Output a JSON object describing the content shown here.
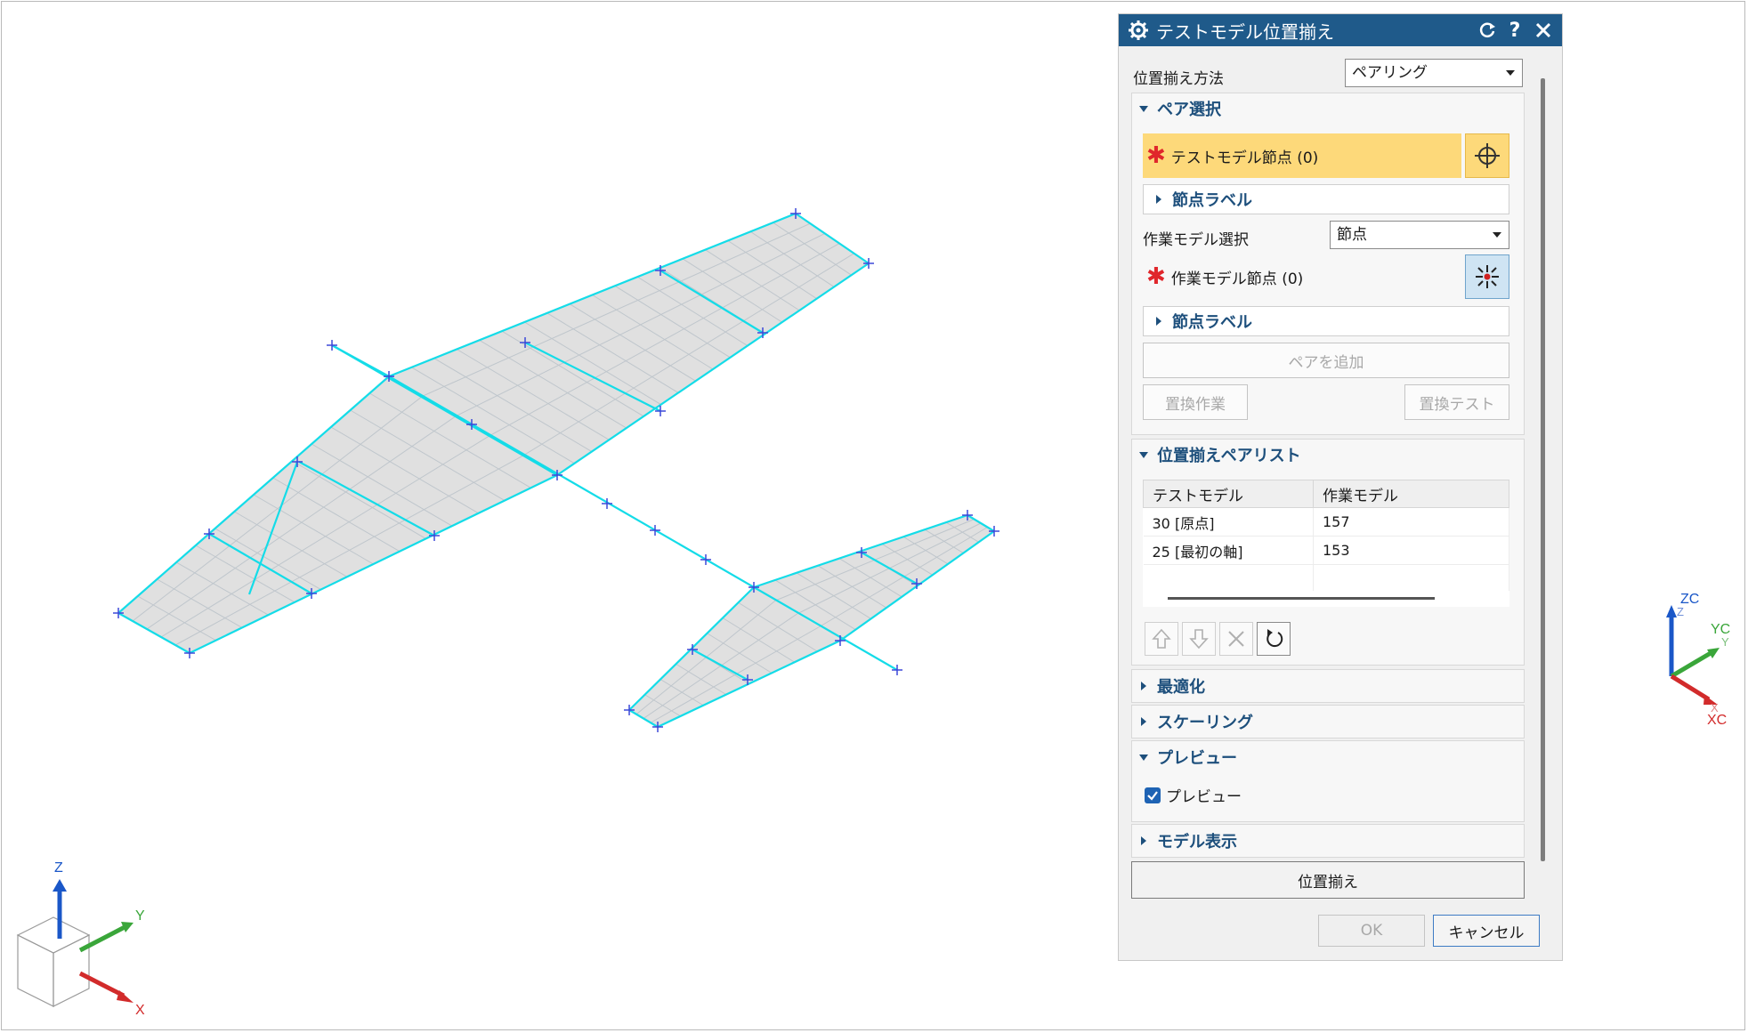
{
  "dialog": {
    "title": "テストモデル位置揃え",
    "method_label": "位置揃え方法",
    "method_value": "ペアリング",
    "pair_selection": {
      "header": "ペア選択",
      "test_nodes": "テストモデル節点 (0)",
      "node_label_1": "節点ラベル",
      "work_select_label": "作業モデル選択",
      "work_select_value": "節点",
      "work_nodes": "作業モデル節点 (0)",
      "node_label_2": "節点ラベル",
      "add_pair": "ペアを追加",
      "replace_work": "置換作業",
      "replace_test": "置換テスト"
    },
    "pair_list": {
      "header": "位置揃えペアリスト",
      "columns": [
        "テストモデル",
        "作業モデル"
      ],
      "rows": [
        [
          "30 [原点]",
          "157"
        ],
        [
          "25 [最初の軸]",
          "153"
        ],
        [
          "",
          ""
        ]
      ]
    },
    "optimize": "最適化",
    "scaling": "スケーリング",
    "preview_header": "プレビュー",
    "preview_checkbox": "プレビュー",
    "model_display": "モデル表示",
    "align_button": "位置揃え",
    "ok": "OK",
    "cancel": "キャンセル"
  },
  "triad_left": {
    "z": "Z",
    "y": "Y",
    "x": "X"
  },
  "triad_right": {
    "zc": "ZC",
    "z": "Z",
    "yc": "YC",
    "y": "Y",
    "x": "X",
    "xc": "XC"
  },
  "colors": {
    "title_bar": "#1f5a8a",
    "accent": "#1d4f7c",
    "highlight": "#fdd97a",
    "mesh_edge": "#14dce8",
    "shell_fill": "#e0e0e0"
  }
}
